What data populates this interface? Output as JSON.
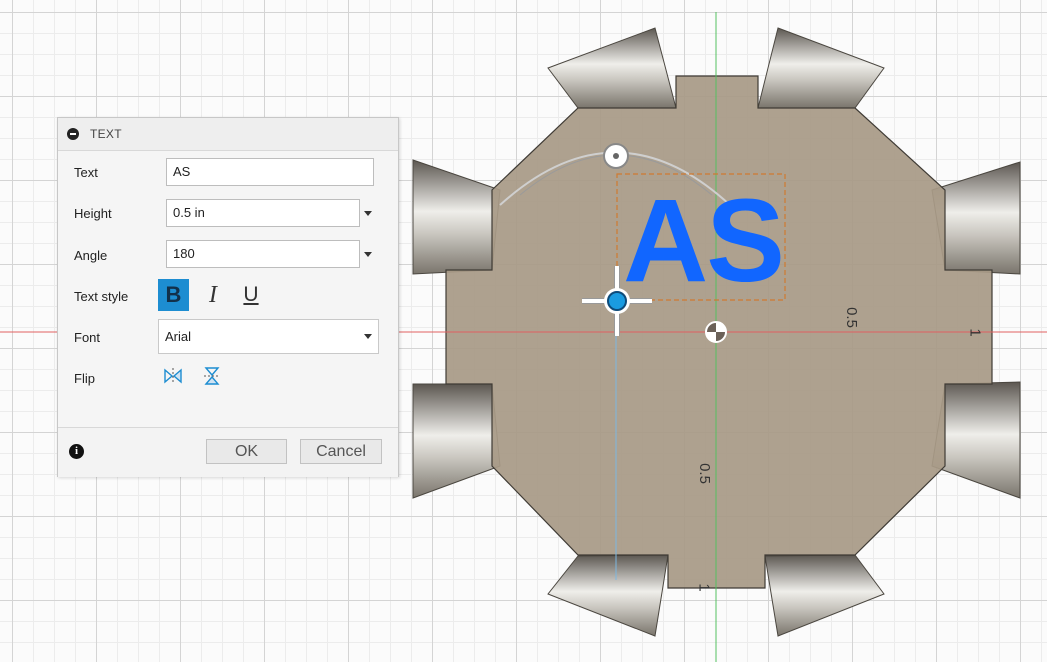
{
  "dialog": {
    "title": "TEXT",
    "fields": {
      "text": {
        "label": "Text",
        "value": "AS"
      },
      "height": {
        "label": "Height",
        "value": "0.5 in"
      },
      "angle": {
        "label": "Angle",
        "value": "180"
      },
      "text_style": {
        "label": "Text style",
        "bold": "B",
        "italic": "I",
        "underline": "U",
        "bold_active": true
      },
      "font": {
        "label": "Font",
        "value": "Arial"
      },
      "flip": {
        "label": "Flip"
      }
    },
    "ok_label": "OK",
    "cancel_label": "Cancel",
    "info_icon": "i"
  },
  "viewport": {
    "sketch_text": "AS",
    "sketch_text_color": "#1166ff",
    "dimensions": {
      "vertical_dim": "0.5",
      "horizontal_dim": "0.5",
      "bottom_ruler": "1",
      "right_ruler": "1"
    },
    "icons": {
      "origin": "origin-icon",
      "move_handle": "move-handle-icon",
      "rotate_handle": "rotate-handle-icon"
    },
    "colors": {
      "part_fill": "#a89a86",
      "x_axis": "#e06060",
      "y_axis": "#55c060",
      "selection_accent": "#1d8dd1"
    }
  }
}
